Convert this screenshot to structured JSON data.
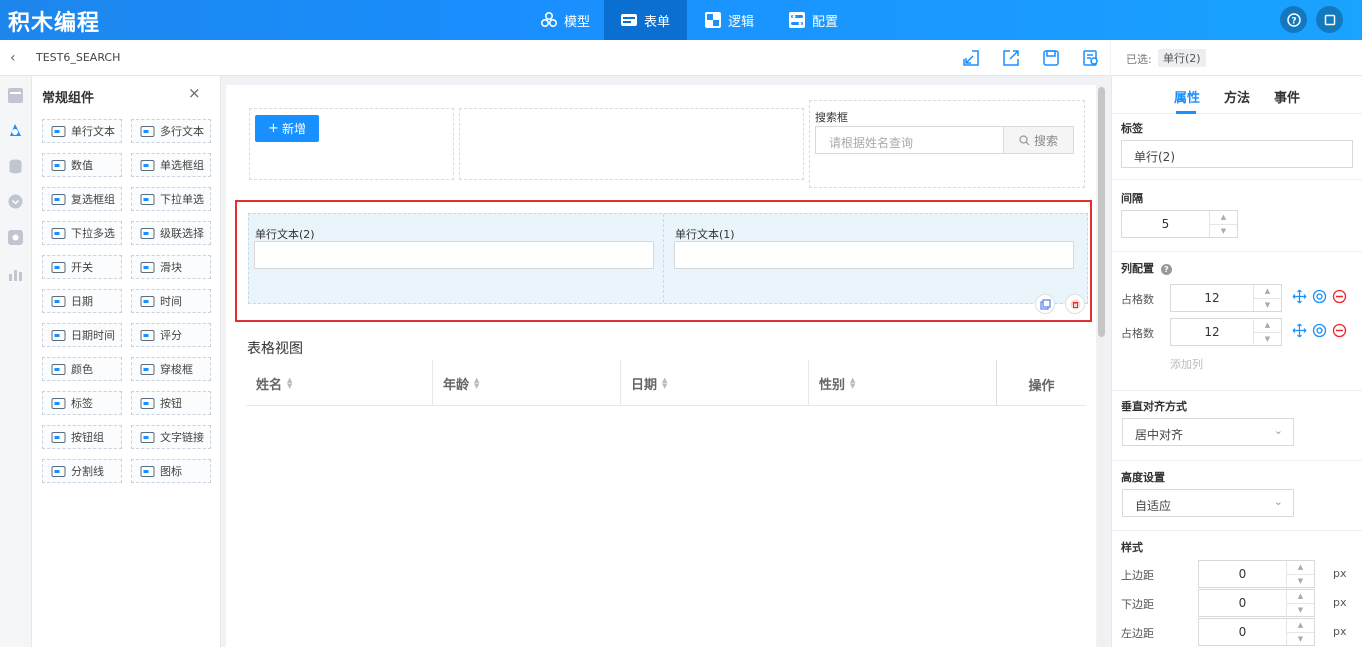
{
  "app": {
    "logo": "积木编程"
  },
  "nav": [
    {
      "label": "模型",
      "icon": "cubes-icon"
    },
    {
      "label": "表单",
      "icon": "form-icon"
    },
    {
      "label": "逻辑",
      "icon": "logic-icon"
    },
    {
      "label": "配置",
      "icon": "config-icon"
    }
  ],
  "subbar": {
    "title": "TEST6_SEARCH"
  },
  "selected": {
    "label": "已选:",
    "value": "单行(2)"
  },
  "palette": {
    "title": "常规组件",
    "items": [
      "单行文本",
      "多行文本",
      "数值",
      "单选框组",
      "复选框组",
      "下拉单选",
      "下拉多选",
      "级联选择",
      "开关",
      "滑块",
      "日期",
      "时间",
      "日期时间",
      "评分",
      "颜色",
      "穿梭框",
      "标签",
      "按钮",
      "按钮组",
      "文字链接",
      "分割线",
      "图标"
    ]
  },
  "canvas": {
    "add_button": "新增",
    "search": {
      "label": "搜索框",
      "placeholder": "请根据姓名查询",
      "button": "搜索"
    },
    "row_fields": [
      {
        "label": "单行文本(2)"
      },
      {
        "label": "单行文本(1)"
      }
    ],
    "table_title": "表格视图",
    "columns": [
      "姓名",
      "年龄",
      "日期",
      "性别",
      "操作"
    ]
  },
  "props": {
    "tabs": [
      "属性",
      "方法",
      "事件"
    ],
    "label_title": "标签",
    "label_value": "单行(2)",
    "gap_title": "间隔",
    "gap_value": "5",
    "cols_title": "列配置",
    "cols": [
      {
        "label": "占格数",
        "value": "12"
      },
      {
        "label": "占格数",
        "value": "12"
      }
    ],
    "add_col": "添加列",
    "valign_title": "垂直对齐方式",
    "valign_value": "居中对齐",
    "height_title": "高度设置",
    "height_value": "自适应",
    "style_title": "样式",
    "margins": [
      {
        "label": "上边距",
        "value": "0",
        "unit": "px"
      },
      {
        "label": "下边距",
        "value": "0",
        "unit": "px"
      },
      {
        "label": "左边距",
        "value": "0",
        "unit": "px"
      }
    ]
  },
  "colors": {
    "primary": "#1890ff",
    "selection": "#e03030",
    "row_bg": "#e9f5fb",
    "danger": "#f5222d"
  }
}
